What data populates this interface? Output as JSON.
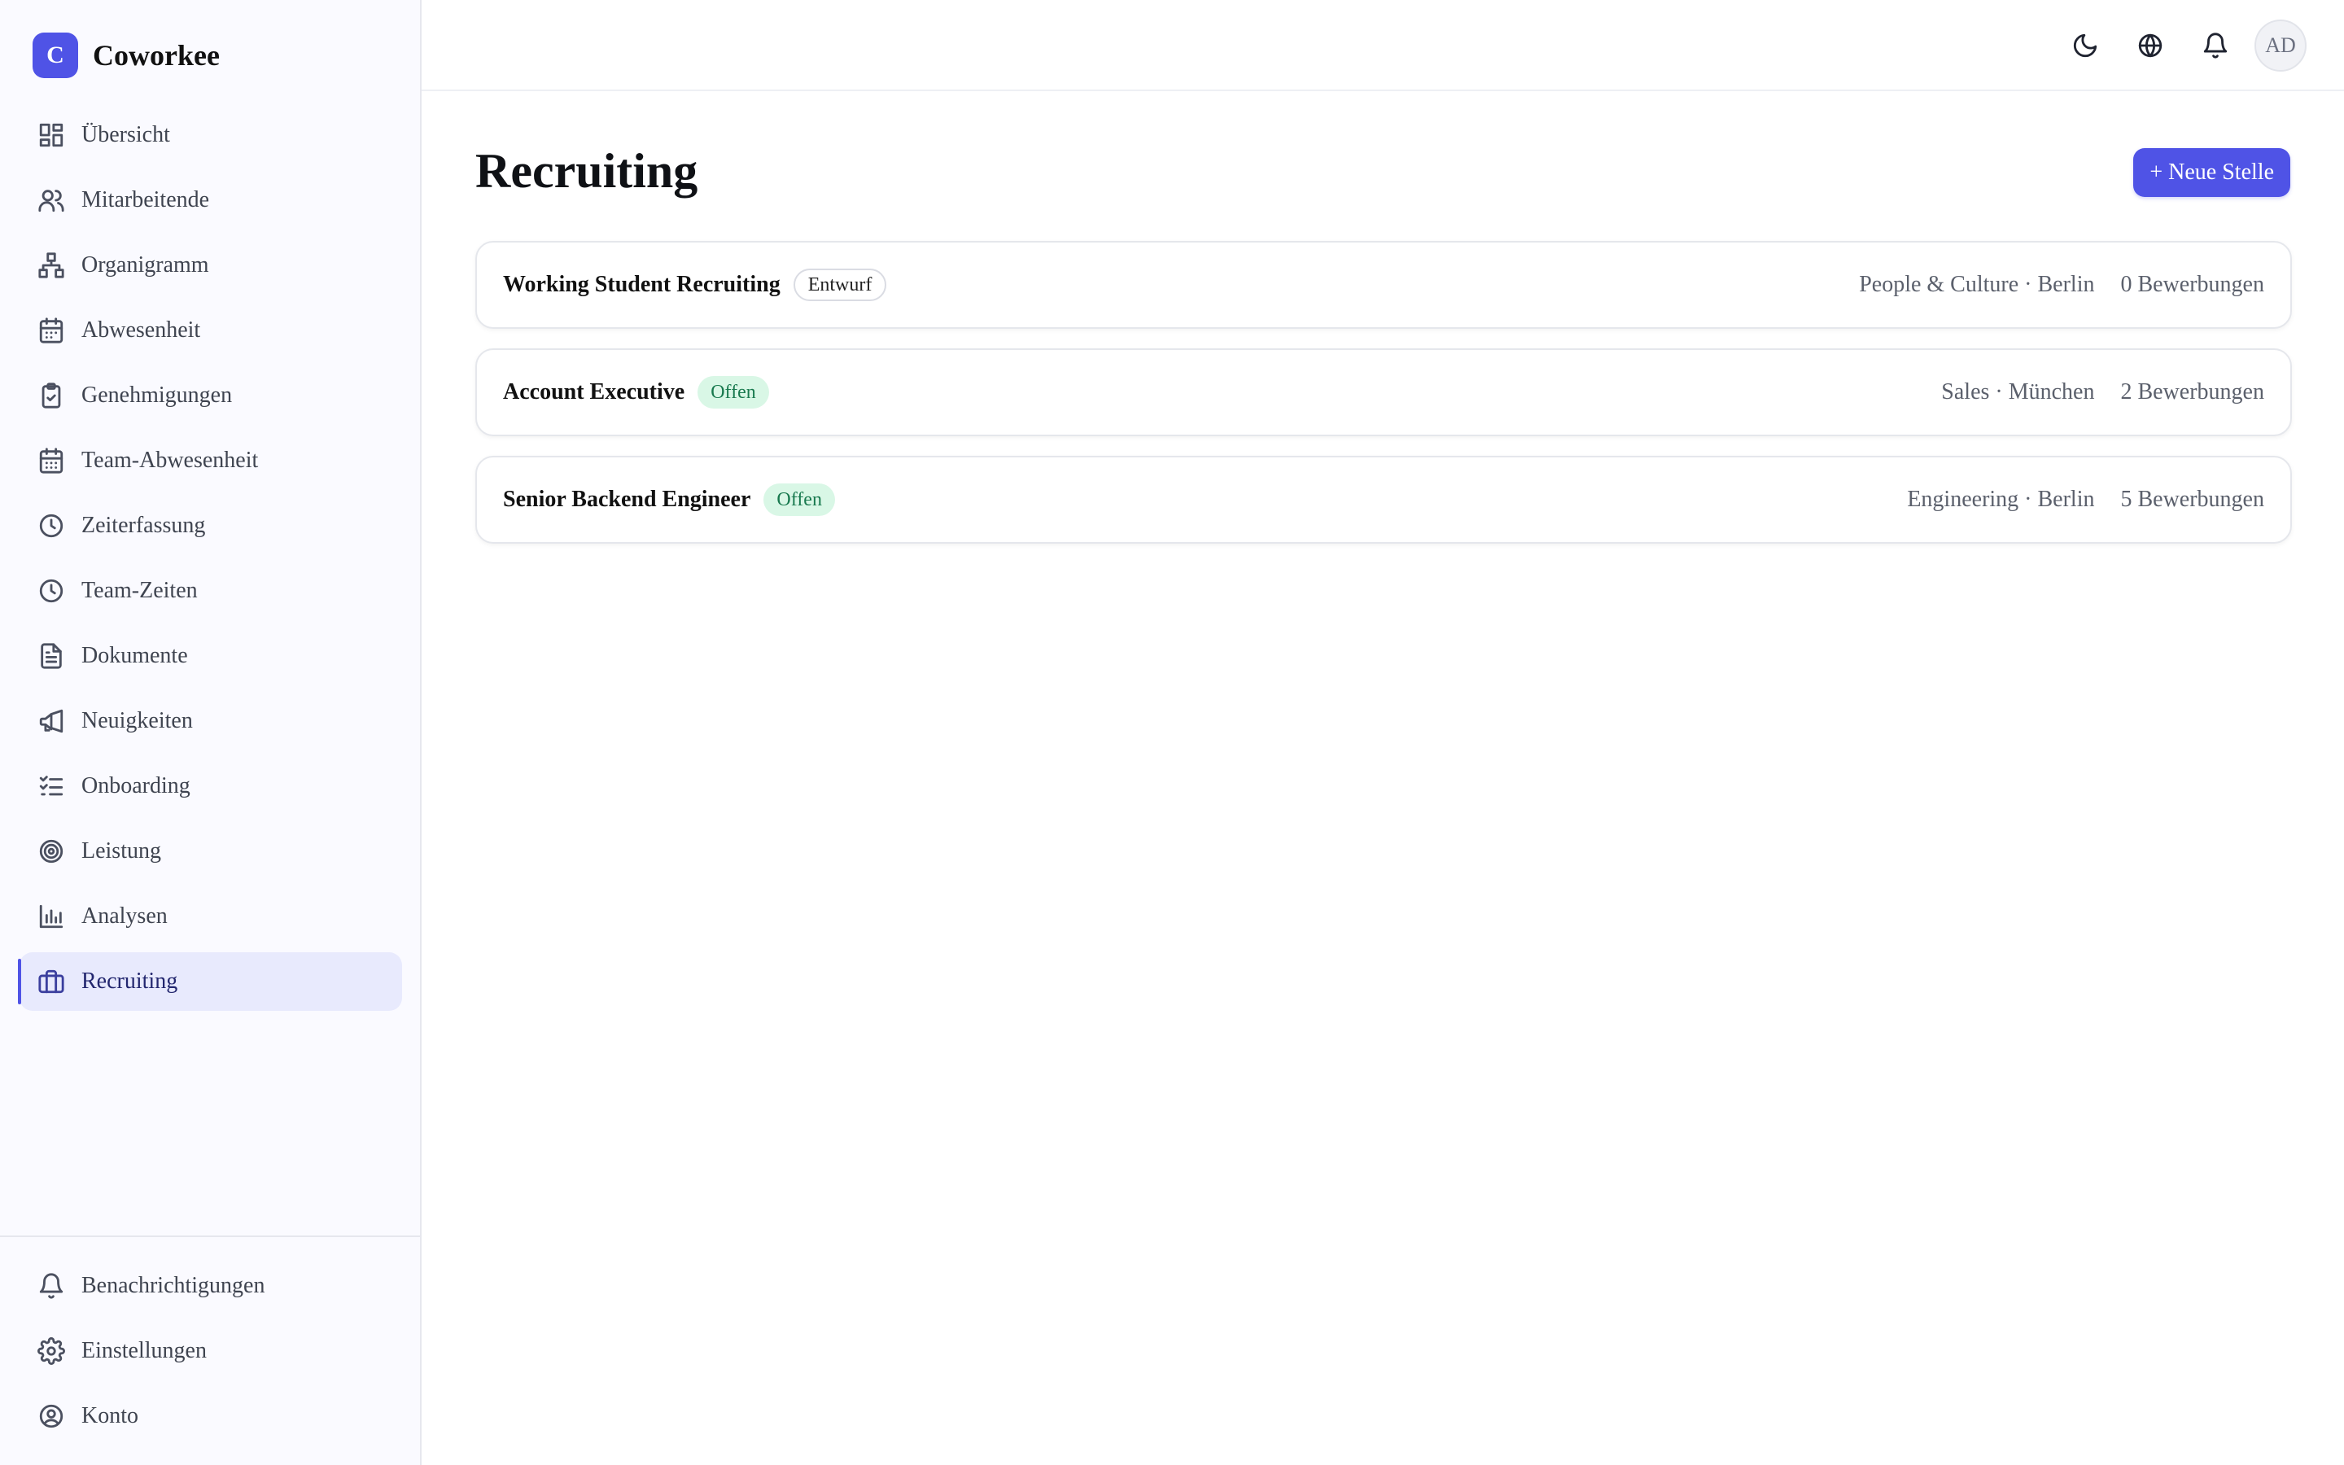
{
  "brand": {
    "logo_letter": "C",
    "name": "Coworkee",
    "accent": "#4f53e6"
  },
  "sidebar": {
    "items": [
      {
        "label": "Übersicht",
        "icon": "dashboard-icon"
      },
      {
        "label": "Mitarbeitende",
        "icon": "users-icon"
      },
      {
        "label": "Organigramm",
        "icon": "org-chart-icon"
      },
      {
        "label": "Abwesenheit",
        "icon": "calendar-icon"
      },
      {
        "label": "Genehmigungen",
        "icon": "clipboard-check-icon"
      },
      {
        "label": "Team-Abwesenheit",
        "icon": "calendar-team-icon"
      },
      {
        "label": "Zeiterfassung",
        "icon": "clock-icon"
      },
      {
        "label": "Team-Zeiten",
        "icon": "clock-team-icon"
      },
      {
        "label": "Dokumente",
        "icon": "document-icon"
      },
      {
        "label": "Neuigkeiten",
        "icon": "megaphone-icon"
      },
      {
        "label": "Onboarding",
        "icon": "checklist-icon"
      },
      {
        "label": "Leistung",
        "icon": "target-icon"
      },
      {
        "label": "Analysen",
        "icon": "bar-chart-icon"
      },
      {
        "label": "Recruiting",
        "icon": "briefcase-icon",
        "active": true
      }
    ],
    "bottom_items": [
      {
        "label": "Benachrichtigungen",
        "icon": "bell-icon"
      },
      {
        "label": "Einstellungen",
        "icon": "gear-icon"
      },
      {
        "label": "Konto",
        "icon": "user-circle-icon"
      }
    ]
  },
  "header": {
    "icons": [
      "moon-icon",
      "globe-icon",
      "bell-icon"
    ],
    "avatar_initials": "AD"
  },
  "main": {
    "title": "Recruiting",
    "new_button_label": "+ Neue Stelle",
    "jobs": [
      {
        "title": "Working Student Recruiting",
        "status": "Entwurf",
        "status_type": "draft",
        "meta": "People & Culture · Berlin",
        "applications": "0 Bewerbungen"
      },
      {
        "title": "Account Executive",
        "status": "Offen",
        "status_type": "open",
        "meta": "Sales · München",
        "applications": "2 Bewerbungen"
      },
      {
        "title": "Senior Backend Engineer",
        "status": "Offen",
        "status_type": "open",
        "meta": "Engineering · Berlin",
        "applications": "5 Bewerbungen"
      }
    ]
  }
}
